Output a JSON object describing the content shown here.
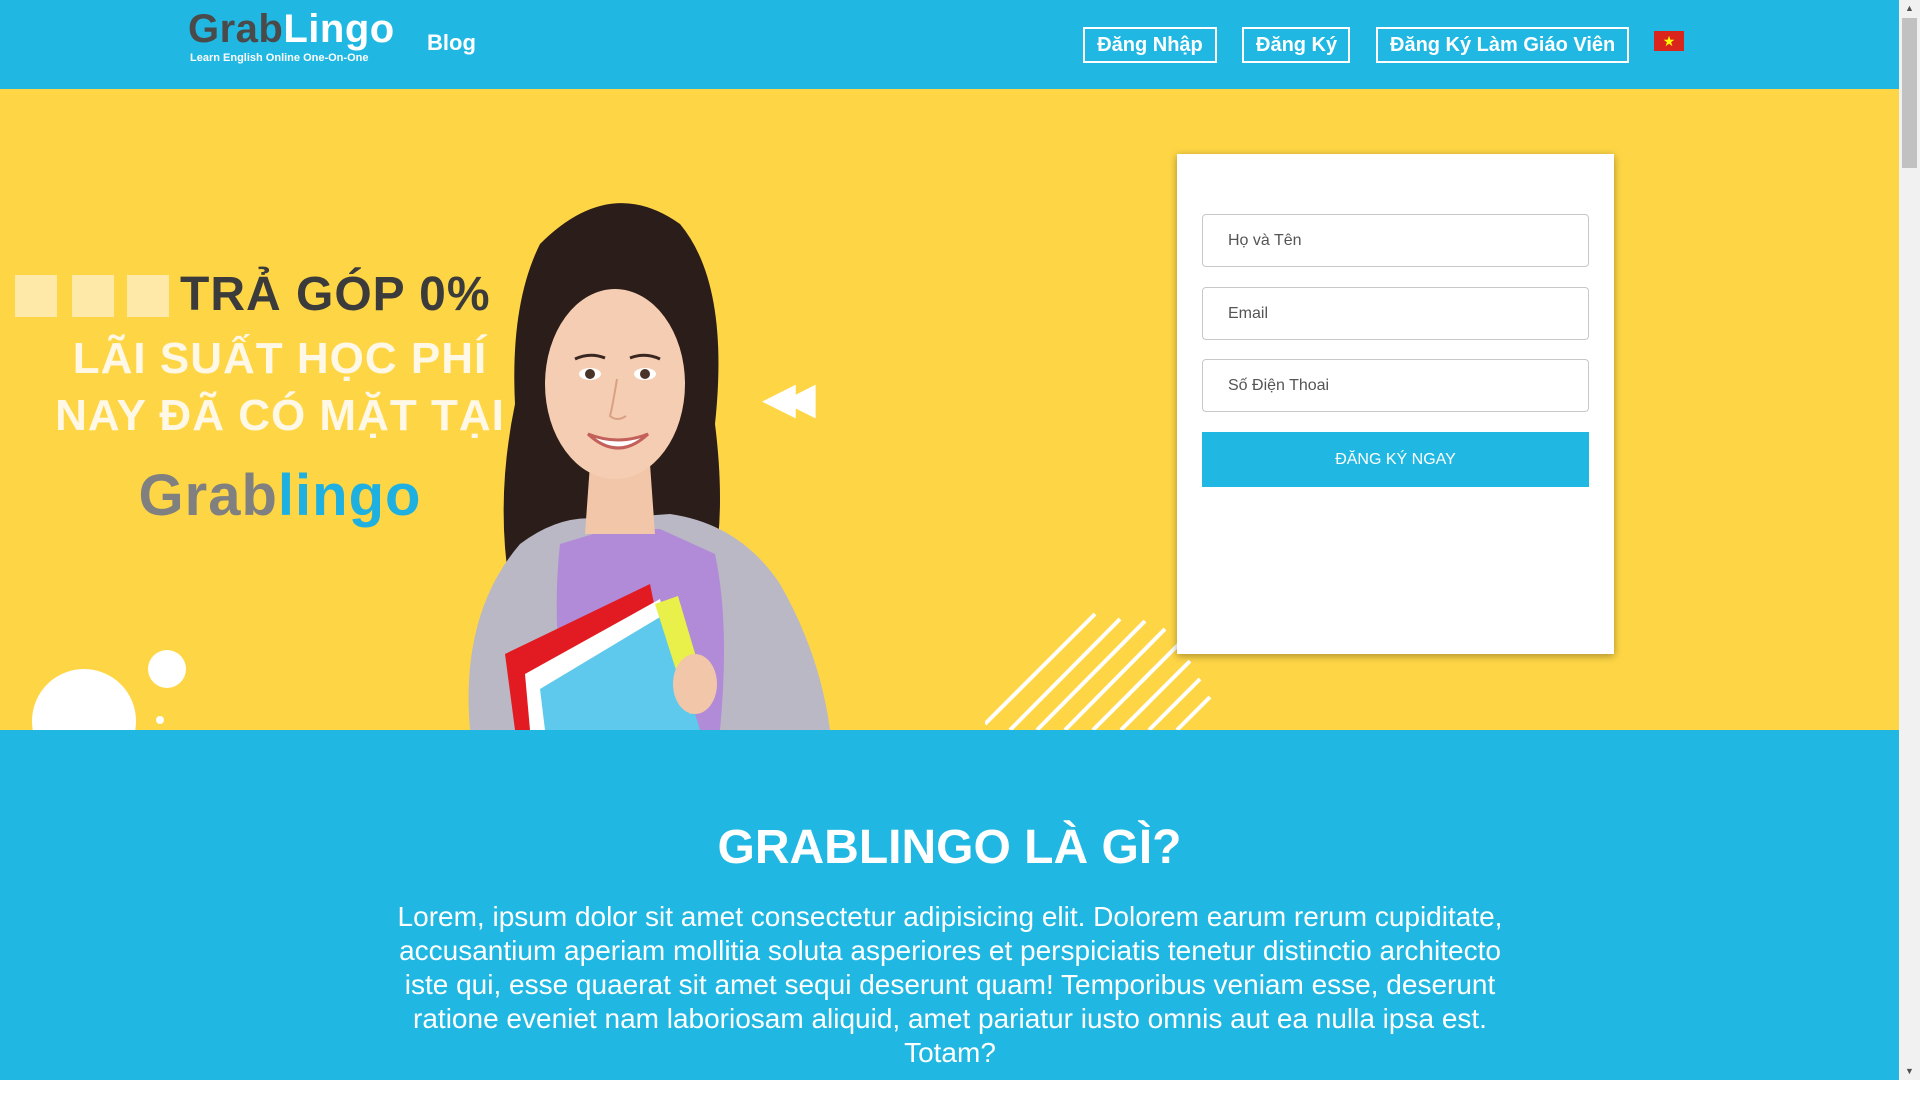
{
  "header": {
    "logo": {
      "word_part1": "Grab",
      "word_part2": "Lingo",
      "tagline": "Learn English Online One-On-One"
    },
    "nav_blog": "Blog",
    "buttons": {
      "login": "Đăng Nhập",
      "register": "Đăng Ký",
      "register_teacher": "Đăng Ký Làm Giáo Viên"
    },
    "language_flag": "vietnam-flag-icon"
  },
  "hero": {
    "promo_line1": "TRẢ GÓP 0%",
    "promo_line2": "LÃI SUẤT HỌC PHÍ",
    "promo_line3": "NAY ĐÃ CÓ MẶT TẠI",
    "brand_part1": "Grab",
    "brand_part2": "lingo",
    "background_color": "#fed645"
  },
  "form": {
    "name_placeholder": "Họ và Tên",
    "email_placeholder": "Email",
    "phone_placeholder": "Số Điện Thoai",
    "submit_label": "ĐĂNG KÝ NGAY",
    "accent_color": "#20b8e2"
  },
  "about": {
    "title": "GRABLINGO LÀ GÌ?",
    "text": "Lorem, ipsum dolor sit amet consectetur adipisicing elit. Dolorem earum rerum cupiditate, accusantium aperiam mollitia soluta asperiores et perspiciatis tenetur distinctio architecto iste qui, esse quaerat sit amet sequi deserunt quam! Temporibus veniam esse, deserunt ratione eveniet nam laboriosam aliquid, amet pariatur iusto omnis aut ea nulla ipsa est. Totam?"
  }
}
